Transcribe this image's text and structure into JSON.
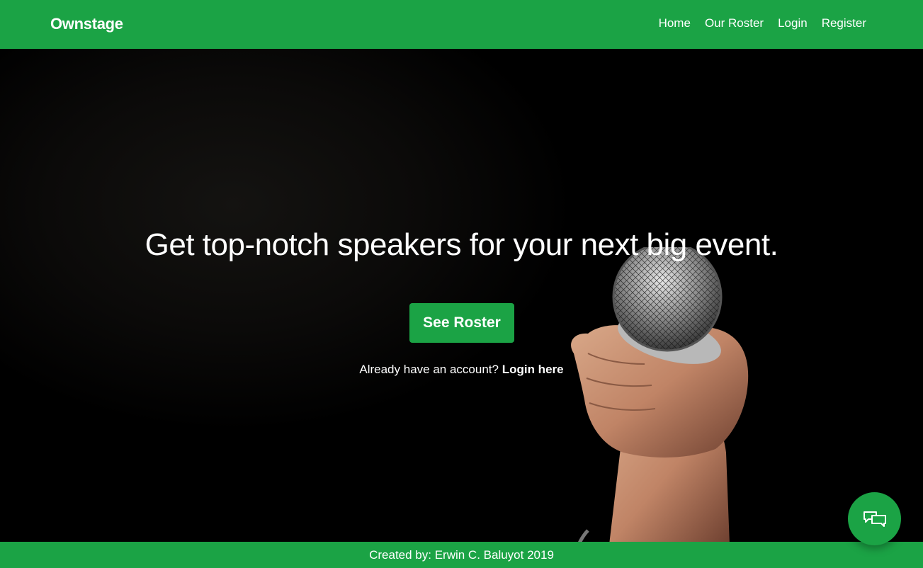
{
  "brand": "Ownstage",
  "nav": {
    "links": [
      "Home",
      "Our Roster",
      "Login",
      "Register"
    ]
  },
  "hero": {
    "headline": "Get top-notch speakers for your next big event.",
    "cta_label": "See Roster",
    "account_prompt": "Already have an account?",
    "account_link": "Login here"
  },
  "footer": {
    "credit": "Created by: Erwin C. Baluyot 2019"
  },
  "chat": {
    "icon": "chat-bubbles-icon"
  },
  "colors": {
    "brand_green": "#1ba345",
    "hero_bg": "#000000",
    "text": "#ffffff"
  }
}
